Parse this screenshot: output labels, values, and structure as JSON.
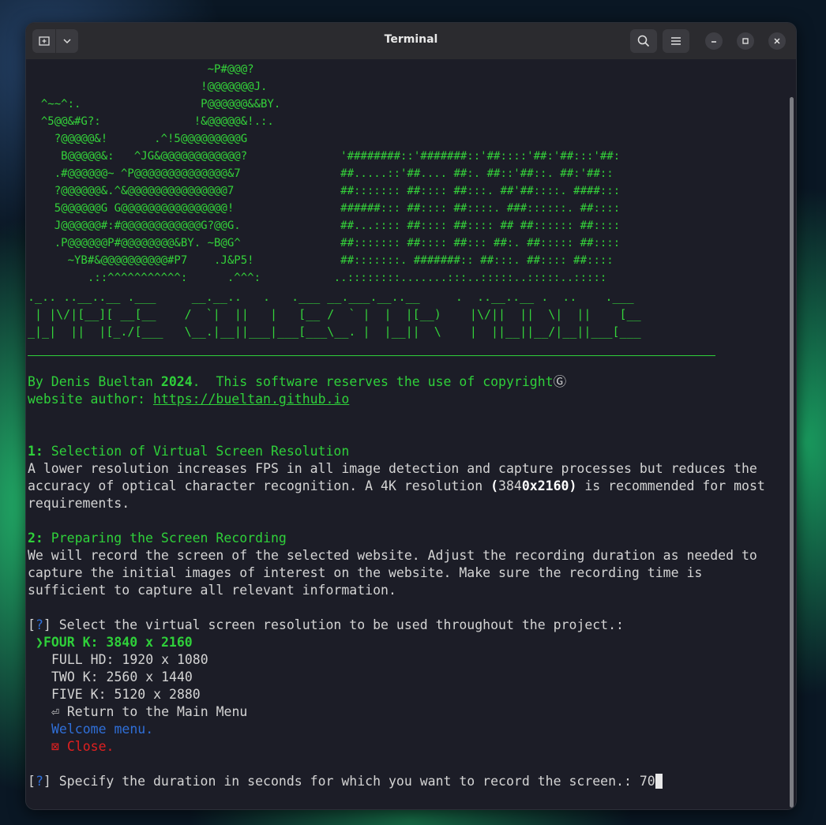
{
  "window": {
    "title": "Terminal"
  },
  "logo_art": [
    "                           ~P#@@@?",
    "                          !@@@@@@@J.",
    "  ^~~^:.                  P@@@@@@&&BY.",
    "  ^5@@&#G?:              !&@@@@@&!.:.",
    "    ?@@@@@&!       .^!5@@@@@@@@@G",
    "     B@@@@@&:   ^JG&@@@@@@@@@@@@?              '########::'#######::'##::::'##:'##:::'##:",
    "    .#@@@@@@~ ^P@@@@@@@@@@@@@@&7               ##.....::'##.... ##:. ##::'##::. ##:'##::",
    "    ?@@@@@@&.^&@@@@@@@@@@@@@@@7                ##::::::: ##:::: ##:::. ##'##::::. ####:::",
    "    5@@@@@@G G@@@@@@@@@@@@@@@@!                ######::: ##:::: ##::::. ###::::::. ##::::",
    "    J@@@@@@#:#@@@@@@@@@@@@G?@@G.               ##...:::: ##:::: ##:::: ## ##:::::: ##::::",
    "    .P@@@@@@P#@@@@@@@@&BY. ~B@G^               ##::::::: ##:::: ##::: ##:. ##::::: ##::::",
    "      ~YB#&@@@@@@@@@@#P7    .J&P5!             ##:::::::. #######:: ##:::. ##:::: ##::::",
    "         .::^^^^^^^^^^^:      .^^^:           ..::::::::.......:::..:::::..:::::..:::::"
  ],
  "title_art": [
    "._.. ..__..__ .___     __.__..   .   .___ __.___.__..__     .  ..__..__ .  ..    .___",
    " | |\\/|[__][ __[__    /  `|  ||   |   [__ /  ` |  |  |[__)    |\\/||  ||  \\|  ||    [__",
    "_|_|  ||  |[_./[___   \\__.|__||___|___[___\\__. |  |__||  \\    |  ||__||__/|__||___[___"
  ],
  "credits": {
    "by": "By Denis Bueltan ",
    "year": "2024",
    "rights": ".  This software reserves the use of copyright",
    "copyright_symbol": "Ⓖ",
    "website_label": "website author: ",
    "website_url": "https://bueltan.github.io"
  },
  "section1": {
    "number": "1:",
    "title": " Selection of Virtual Screen Resolution",
    "line1": "A lower resolution increases FPS in all image detection and capture processes but reduces the",
    "line2a": "accuracy of optical character recognition. A 4K resolution ",
    "line2_paren_open": "(",
    "line2_num": "384",
    "line2_bold": "0x2160)",
    "line2b": " is recommended for most",
    "line3": "requirements."
  },
  "section2": {
    "number": "2:",
    "title": " Preparing the Screen Recording",
    "line1": "We will record the screen of the selected website. Adjust the recording duration as needed to",
    "line2": "capture the initial images of interest on the website. Make sure the recording time is",
    "line3": "sufficient to capture all relevant information."
  },
  "prompt1": {
    "open": "[",
    "mark": "?",
    "close": "]",
    "question": " Select the virtual screen resolution to be used throughout the project.:",
    "pointer": "❯",
    "options": [
      "FOUR K: 3840 x 2160",
      "FULL HD: 1920 x 1080",
      "TWO K: 2560 x 1440",
      "FIVE K: 5120 x 2880",
      "⏎ Return to the Main Menu",
      "Welcome menu.",
      "⊠ Close."
    ],
    "selected": "FOUR K: 3840 x 2160"
  },
  "prompt2": {
    "open": "[",
    "mark": "?",
    "close": "]",
    "question": " Specify the duration in seconds for which you want to record the screen.: ",
    "answer": "70"
  },
  "colors": {
    "green": "#2fd03a",
    "blue": "#2f6fd8",
    "red": "#e02020",
    "terminal_bg": "#1c1d27"
  },
  "icons": [
    "new-tab-icon",
    "chevron-down-icon",
    "search-icon",
    "hamburger-menu-icon",
    "minimize-icon",
    "maximize-icon",
    "close-icon"
  ]
}
